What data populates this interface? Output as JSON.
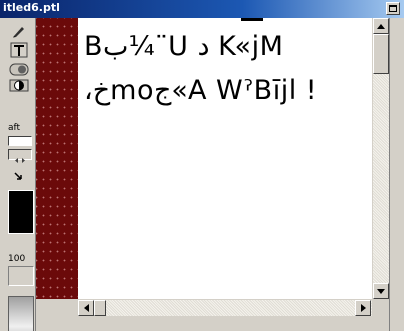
{
  "window": {
    "title": "itled6.ptl"
  },
  "toolbox": {
    "tools": [
      {
        "name": "pencil-tool",
        "icon": "pencil-icon"
      },
      {
        "name": "text-tool",
        "icon": "text-icon"
      },
      {
        "name": "toggle-tool-a",
        "icon": "toggle-icon"
      },
      {
        "name": "toggle-tool-b",
        "icon": "half-circle-icon"
      }
    ],
    "draft_label": "aft",
    "zoom_value": "100"
  },
  "canvas": {
    "line1": "Bب¼¨U  د   K«jM",
    "line2": "،خmoج«A WˀBījl !"
  },
  "colors": {
    "titlebar_start": "#0a246a",
    "titlebar_end": "#a6caf0",
    "margin": "#6b0a0a",
    "canvas": "#ffffff",
    "chrome": "#d4d0c8"
  }
}
